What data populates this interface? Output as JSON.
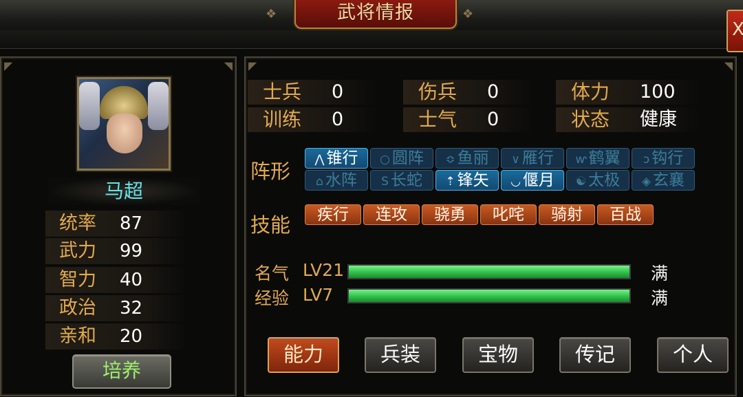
{
  "window": {
    "title": "武将情报",
    "close_glyph": "X"
  },
  "general": {
    "name": "马超",
    "stats": [
      {
        "label": "统率",
        "value": "87"
      },
      {
        "label": "武力",
        "value": "99"
      },
      {
        "label": "智力",
        "value": "40"
      },
      {
        "label": "政治",
        "value": "32"
      },
      {
        "label": "亲和",
        "value": "20"
      }
    ],
    "train_button": "培养"
  },
  "info": [
    {
      "label": "士兵",
      "value": "0"
    },
    {
      "label": "伤兵",
      "value": "0"
    },
    {
      "label": "体力",
      "value": "100"
    },
    {
      "label": "训练",
      "value": "0"
    },
    {
      "label": "士气",
      "value": "0"
    },
    {
      "label": "状态",
      "value": "健康"
    }
  ],
  "formation": {
    "label": "阵形",
    "items": [
      {
        "icon": "arrow-up-icon",
        "glyph": "⋀",
        "label": "锥行",
        "active": true
      },
      {
        "icon": "circle-icon",
        "glyph": "○",
        "label": "圆阵",
        "active": false
      },
      {
        "icon": "fish-scale-icon",
        "glyph": "≎",
        "label": "鱼丽",
        "active": false
      },
      {
        "icon": "v-shape-icon",
        "glyph": "∨",
        "label": "雁行",
        "active": false
      },
      {
        "icon": "wing-icon",
        "glyph": "ⱳ",
        "label": "鹤翼",
        "active": false
      },
      {
        "icon": "hook-icon",
        "glyph": "ↄ",
        "label": "钩行",
        "active": false
      },
      {
        "icon": "water-icon",
        "glyph": "⌂",
        "label": "水阵",
        "active": false
      },
      {
        "icon": "snake-icon",
        "glyph": "S",
        "label": "长蛇",
        "active": false
      },
      {
        "icon": "arrowhead-icon",
        "glyph": "⇡",
        "label": "锋矢",
        "active": true
      },
      {
        "icon": "crescent-icon",
        "glyph": "◡",
        "label": "偃月",
        "active": true
      },
      {
        "icon": "taiji-icon",
        "glyph": "☯",
        "label": "太极",
        "active": false
      },
      {
        "icon": "diamond-icon",
        "glyph": "◈",
        "label": "玄襄",
        "active": false
      }
    ]
  },
  "skills": {
    "label": "技能",
    "items": [
      "疾行",
      "连攻",
      "骁勇",
      "叱咤",
      "骑射",
      "百战"
    ]
  },
  "progress": [
    {
      "label": "名气",
      "level": "LV21",
      "fill": 1.0,
      "status": "满"
    },
    {
      "label": "经验",
      "level": "LV7",
      "fill": 1.0,
      "status": "满"
    }
  ],
  "tabs": [
    {
      "label": "能力",
      "active": true
    },
    {
      "label": "兵装",
      "active": false
    },
    {
      "label": "宝物",
      "active": false
    },
    {
      "label": "传记",
      "active": false
    },
    {
      "label": "个人",
      "active": false
    }
  ],
  "colors": {
    "label_gold": "#e2aa4e",
    "name_cyan": "#63e4e8",
    "formation_active": "#1a6a9a",
    "skill_orange": "#c85a22",
    "bar_green": "#2ec04a"
  }
}
